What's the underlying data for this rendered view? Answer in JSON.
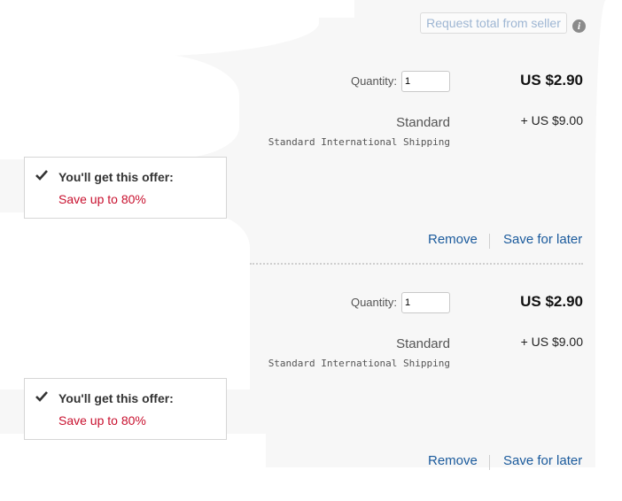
{
  "header": {
    "request_total_label": "Request total from seller",
    "info_icon": "info-icon"
  },
  "items": [
    {
      "quantity_label": "Quantity:",
      "quantity_value": "1",
      "price": "US $2.90",
      "shipping_name": "Standard",
      "shipping_cost": "+ US $9.00",
      "shipping_desc": "Standard International Shipping",
      "offer_title": "You'll get this offer:",
      "offer_save": "Save up to 80%",
      "remove_label": "Remove",
      "save_later_label": "Save for later"
    },
    {
      "quantity_label": "Quantity:",
      "quantity_value": "1",
      "price": "US $2.90",
      "shipping_name": "Standard",
      "shipping_cost": "+ US $9.00",
      "shipping_desc": "Standard International Shipping",
      "offer_title": "You'll get this offer:",
      "offer_save": "Save up to 80%",
      "remove_label": "Remove",
      "save_later_label": "Save for later"
    }
  ],
  "colors": {
    "link": "#1a5a9c",
    "offer_red": "#c8102e",
    "panel_bg": "#f7f7f7"
  }
}
